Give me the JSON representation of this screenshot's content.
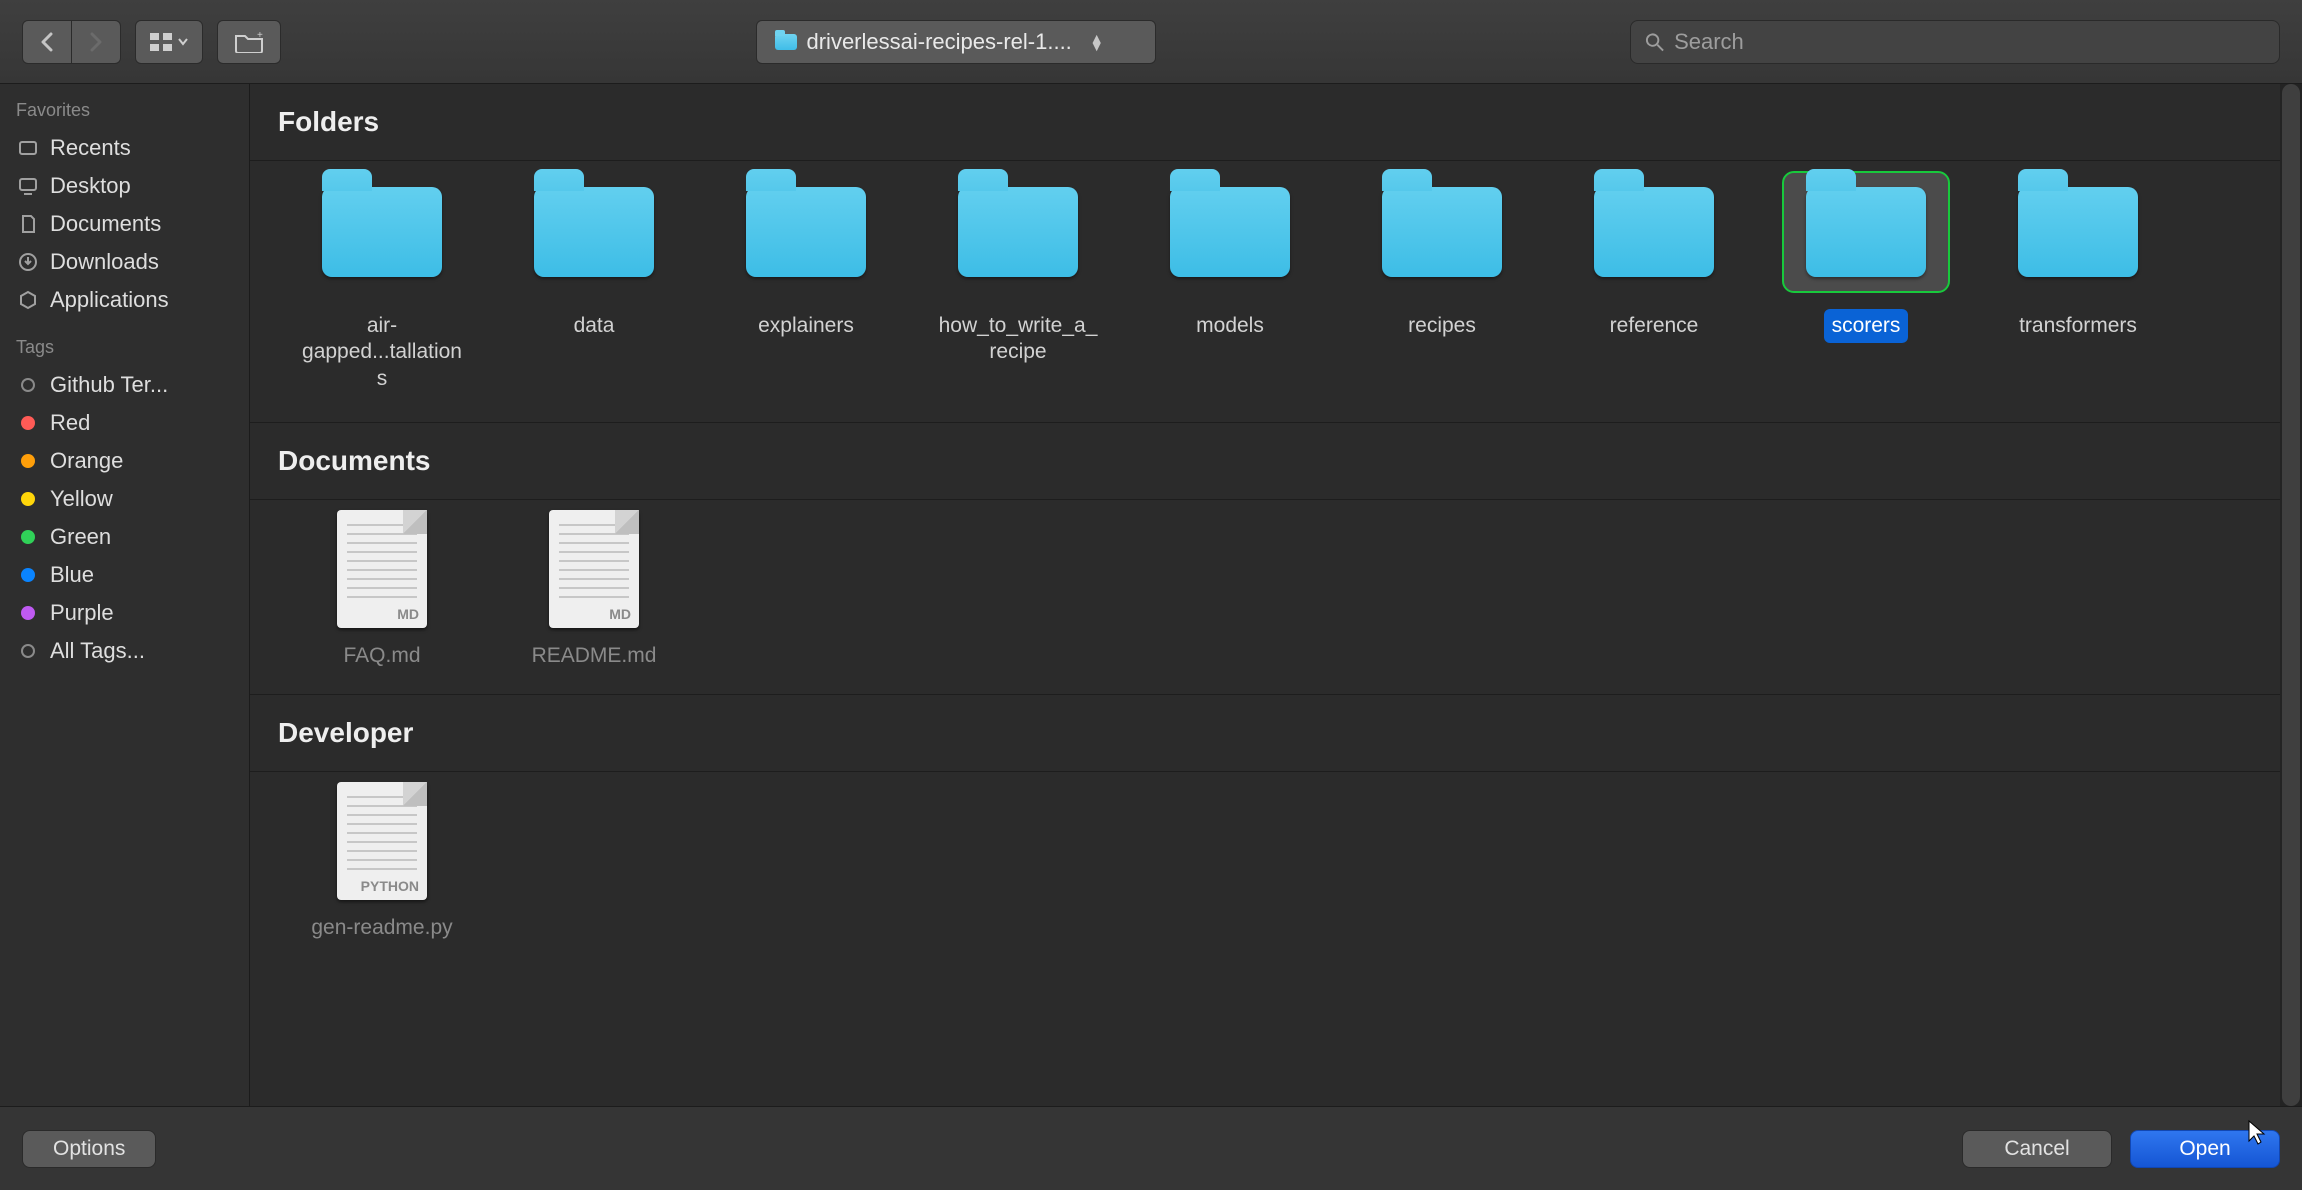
{
  "toolbar": {
    "path_label": "driverlessai-recipes-rel-1....",
    "search_placeholder": "Search"
  },
  "sidebar": {
    "favorites_header": "Favorites",
    "favorites": [
      {
        "label": "Recents"
      },
      {
        "label": "Desktop"
      },
      {
        "label": "Documents"
      },
      {
        "label": "Downloads"
      },
      {
        "label": "Applications"
      }
    ],
    "tags_header": "Tags",
    "tags": [
      {
        "label": "Github Ter...",
        "color": null
      },
      {
        "label": "Red",
        "color": "#ff5b56"
      },
      {
        "label": "Orange",
        "color": "#ff9f0a"
      },
      {
        "label": "Yellow",
        "color": "#ffd60a"
      },
      {
        "label": "Green",
        "color": "#30d158"
      },
      {
        "label": "Blue",
        "color": "#0a84ff"
      },
      {
        "label": "Purple",
        "color": "#bf5af2"
      },
      {
        "label": "All Tags...",
        "color": null
      }
    ]
  },
  "sections": {
    "folders_header": "Folders",
    "folders": [
      {
        "label": "air-gapped...tallations",
        "selected": false
      },
      {
        "label": "data",
        "selected": false
      },
      {
        "label": "explainers",
        "selected": false
      },
      {
        "label": "how_to_write_a_recipe",
        "selected": false
      },
      {
        "label": "models",
        "selected": false
      },
      {
        "label": "recipes",
        "selected": false
      },
      {
        "label": "reference",
        "selected": false
      },
      {
        "label": "scorers",
        "selected": true
      },
      {
        "label": "transformers",
        "selected": false
      }
    ],
    "documents_header": "Documents",
    "documents": [
      {
        "label": "FAQ.md",
        "badge": "MD"
      },
      {
        "label": "README.md",
        "badge": "MD"
      }
    ],
    "developer_header": "Developer",
    "developer": [
      {
        "label": "gen-readme.py",
        "badge": "PYTHON"
      }
    ]
  },
  "footer": {
    "options_label": "Options",
    "cancel_label": "Cancel",
    "open_label": "Open"
  }
}
